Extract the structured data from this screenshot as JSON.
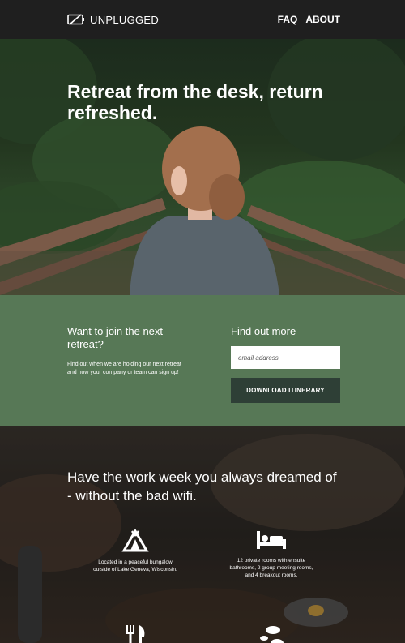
{
  "header": {
    "brand": "UNPLUGGED",
    "nav": [
      {
        "label": "FAQ"
      },
      {
        "label": "ABOUT"
      }
    ]
  },
  "hero": {
    "headline": "Retreat from the desk, return refreshed."
  },
  "signup": {
    "join_heading": "Want to join the next retreat?",
    "join_text": "Find out when we are holding our next retreat and how your company or team can sign up!",
    "findout_heading": "Find out more",
    "email_placeholder": "email address",
    "button_label": "DOWNLOAD ITINERARY"
  },
  "features": {
    "heading": "Have the work week you always dreamed of - without the bad wifi.",
    "items": [
      {
        "icon": "tent-icon",
        "text": "Located in a peaceful bungalow outside of Lake Geneva, Wisconsin."
      },
      {
        "icon": "bed-icon",
        "text": "12 private rooms with ensuite bathrooms, 2 group meeting rooms, and 4 breakout rooms."
      },
      {
        "icon": "utensils-icon",
        "text": ""
      },
      {
        "icon": "footprints-icon",
        "text": ""
      }
    ]
  },
  "colors": {
    "header_bg": "#1f1f1f",
    "signup_bg": "#577856",
    "button_bg": "#2e3f36"
  }
}
